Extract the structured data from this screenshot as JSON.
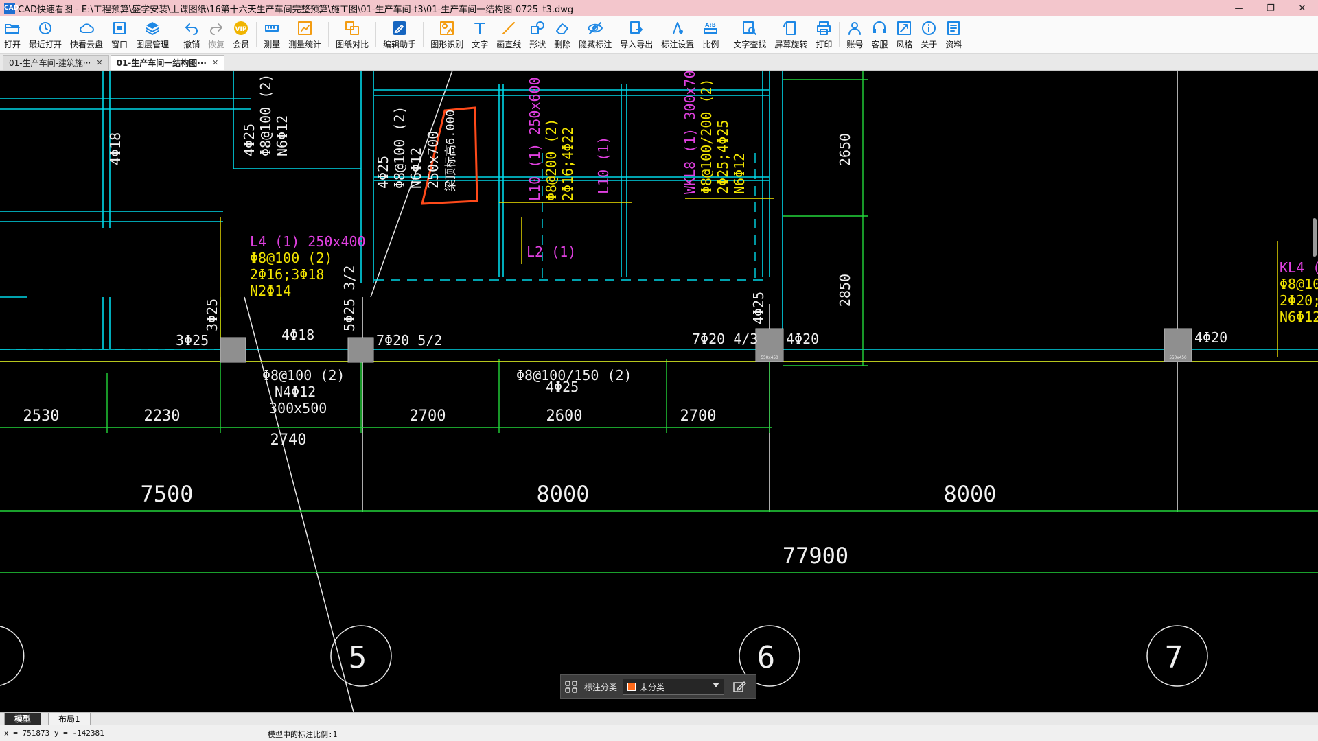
{
  "window": {
    "title": "CAD快速看图 - E:\\工程预算\\盛学安装\\上课图纸\\16第十六天生产车间完整预算\\施工图\\01-生产车间-t3\\01-生产车间一结构图-0725_t3.dwg",
    "app_icon_text": "CAD"
  },
  "toolbar": {
    "items": [
      {
        "key": "open",
        "label": "打开",
        "icon": "folder-open-icon",
        "color": "#1e88e5"
      },
      {
        "key": "recent",
        "label": "最近打开",
        "icon": "history-icon",
        "color": "#1e88e5"
      },
      {
        "key": "cloud",
        "label": "快看云盘",
        "icon": "cloud-icon",
        "color": "#1e88e5"
      },
      {
        "key": "window",
        "label": "窗口",
        "icon": "window-icon",
        "color": "#1e88e5"
      },
      {
        "key": "layers",
        "label": "图层管理",
        "icon": "layers-icon",
        "color": "#1e88e5"
      },
      {
        "key": "undo",
        "label": "撤销",
        "icon": "undo-icon",
        "color": "#1e88e5"
      },
      {
        "key": "redo",
        "label": "恢复",
        "icon": "redo-icon",
        "color": "#9e9e9e",
        "disabled": true
      },
      {
        "key": "vip",
        "label": "会员",
        "icon": "vip-icon",
        "color": "#f0b400"
      },
      {
        "key": "measure",
        "label": "测量",
        "icon": "ruler-icon",
        "color": "#1e88e5"
      },
      {
        "key": "measure_stats",
        "label": "测量统计",
        "icon": "chart-icon",
        "color": "#f39c12"
      },
      {
        "key": "compare",
        "label": "图纸对比",
        "icon": "compare-icon",
        "color": "#f39c12"
      },
      {
        "key": "edit_helper",
        "label": "编辑助手",
        "icon": "edit-helper-icon",
        "color": "#1565c0"
      },
      {
        "key": "shape_recog",
        "label": "图形识别",
        "icon": "shape-recognize-icon",
        "color": "#f39c12"
      },
      {
        "key": "text",
        "label": "文字",
        "icon": "text-icon",
        "color": "#1e88e5"
      },
      {
        "key": "line",
        "label": "画直线",
        "icon": "line-icon",
        "color": "#f39c12"
      },
      {
        "key": "shape",
        "label": "形状",
        "icon": "shape-icon",
        "color": "#1e88e5"
      },
      {
        "key": "delete",
        "label": "删除",
        "icon": "eraser-icon",
        "color": "#1e88e5"
      },
      {
        "key": "hide_mark",
        "label": "隐藏标注",
        "icon": "eye-hide-icon",
        "color": "#1e88e5"
      },
      {
        "key": "import_export",
        "label": "导入导出",
        "icon": "import-export-icon",
        "color": "#1e88e5"
      },
      {
        "key": "mark_settings",
        "label": "标注设置",
        "icon": "mark-settings-icon",
        "color": "#1e88e5"
      },
      {
        "key": "scale",
        "label": "比例",
        "icon": "scale-icon",
        "color": "#1e88e5"
      },
      {
        "key": "text_search",
        "label": "文字查找",
        "icon": "text-search-icon",
        "color": "#1e88e5"
      },
      {
        "key": "rotate",
        "label": "屏幕旋转",
        "icon": "rotate-screen-icon",
        "color": "#1e88e5"
      },
      {
        "key": "print",
        "label": "打印",
        "icon": "printer-icon",
        "color": "#1e88e5"
      },
      {
        "key": "account",
        "label": "账号",
        "icon": "user-icon",
        "color": "#1e88e5"
      },
      {
        "key": "service",
        "label": "客服",
        "icon": "headset-icon",
        "color": "#1e88e5"
      },
      {
        "key": "style",
        "label": "风格",
        "icon": "style-icon",
        "color": "#1e88e5"
      },
      {
        "key": "about",
        "label": "关于",
        "icon": "info-icon",
        "color": "#1e88e5"
      },
      {
        "key": "resources",
        "label": "资料",
        "icon": "resources-icon",
        "color": "#1e88e5"
      }
    ]
  },
  "doc_tabs": [
    {
      "label": "01-生产车间-建筑施···",
      "active": false
    },
    {
      "label": "01-生产车间一结构图···",
      "active": true
    }
  ],
  "drawing": {
    "dims_row1": [
      "2530",
      "2230",
      "2700",
      "2600",
      "2700"
    ],
    "dim_2740": "2740",
    "dims_row2": [
      "7500",
      "8000",
      "8000"
    ],
    "dim_total": "77900",
    "dims_vertical": [
      "2650",
      "2850"
    ],
    "axis_bubbles": [
      "5",
      "6",
      "7"
    ],
    "col_4f18": "4Φ18",
    "beam_L4": [
      "L4 (1) 250x400",
      "Φ8@100 (2)",
      "2Φ16;3Φ18",
      "N2Φ14"
    ],
    "left_rebar": [
      "4Φ25",
      "Φ8@100 (2)",
      "N6Φ12"
    ],
    "mid_rebar": [
      "4Φ25",
      "Φ8@100 (2)",
      "N6Φ12",
      "250x700"
    ],
    "red_note": "梁顶标高6.000",
    "L10_1": [
      "L10 (1) 250x600",
      "Φ8@200 (2)",
      "2Φ16;4Φ22"
    ],
    "L10": "L10 (1)",
    "L2": "L2 (1)",
    "WKL8": [
      "WKL8 (1) 300x700",
      "Φ8@100/200 (2)",
      "2Φ25;4Φ25",
      "N6Φ12"
    ],
    "KL4": [
      "KL4 (6",
      "Φ8@10",
      "2Φ20;3",
      "N6Φ12"
    ],
    "bottom_left": [
      "3Φ25",
      "3Φ25",
      "4Φ18",
      "5Φ25 3/2",
      "7Φ20 5/2",
      "7Φ20 4/3",
      "4Φ25",
      "4Φ20",
      "4Φ20"
    ],
    "under_beam": [
      "Φ8@100 (2)",
      "N4Φ12",
      "300x500"
    ],
    "under_beam2": [
      "Φ8@100/150 (2)",
      "4Φ25"
    ],
    "col_labels": [
      "550x450",
      "550x450"
    ]
  },
  "float_panel": {
    "label": "标注分类",
    "selected": "未分类",
    "swatch_color": "#ff6a1a"
  },
  "layout_tabs": [
    "模型",
    "布局1"
  ],
  "status": {
    "coords": "x = 751873  y = -142381",
    "scale": "模型中的标注比例:1"
  }
}
